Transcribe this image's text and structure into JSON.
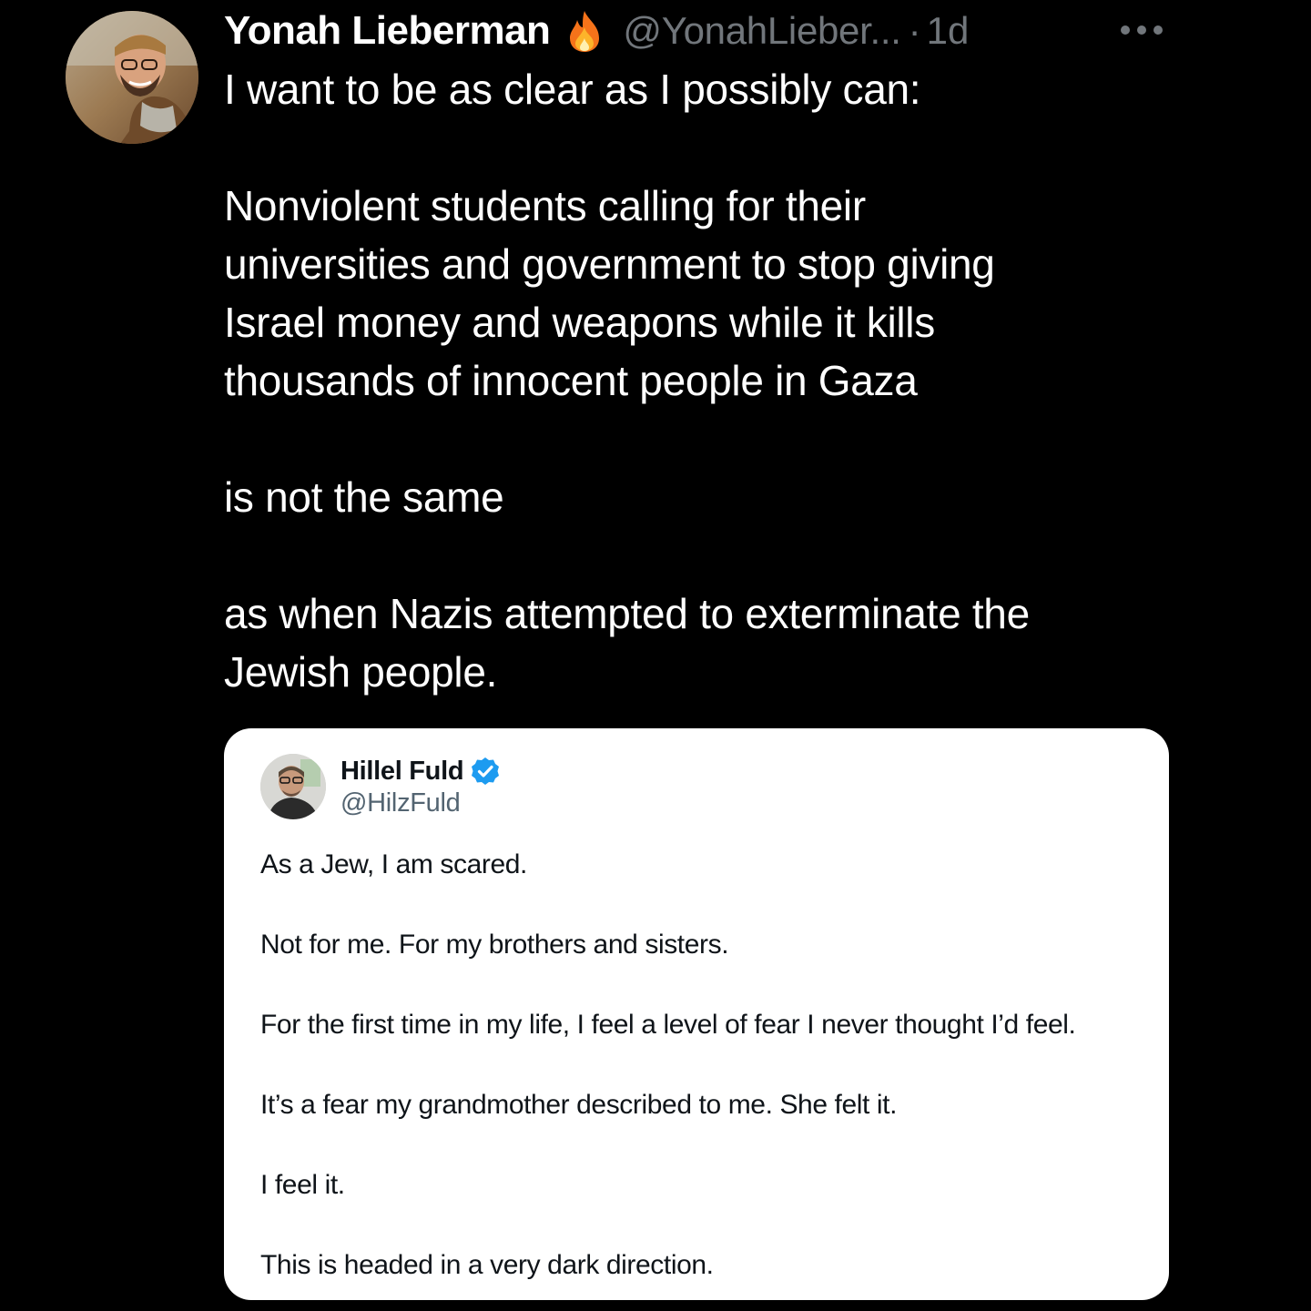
{
  "tweet": {
    "author_name": "Yonah Lieberman",
    "emoji_icon": "fire-icon",
    "handle": "@YonahLieber...",
    "separator": "·",
    "time": "1d",
    "more_icon": "more-horizontal-icon",
    "text_lines": [
      "I want to be as clear as I possibly can:",
      "",
      "Nonviolent students calling for their",
      "universities and government to stop giving",
      "Israel money and weapons while it kills",
      "thousands of innocent people in Gaza",
      "",
      "is not the same",
      "",
      "as when Nazis attempted to exterminate the",
      "Jewish people."
    ]
  },
  "quoted": {
    "author_name": "Hillel Fuld",
    "verified_icon": "verified-badge-icon",
    "handle": "@HilzFuld",
    "paragraphs": [
      "As a Jew, I am scared.",
      "Not for me. For my brothers and sisters.",
      "For the first time in my life, I feel a level of fear I never thought I’d feel.",
      "It’s a fear my grandmother described to me. She felt it.",
      "I feel it.",
      "This is headed in a very dark direction."
    ]
  },
  "colors": {
    "background": "#000000",
    "primary_text": "#ffffff",
    "secondary_text": "#71767b",
    "quote_background": "#ffffff",
    "quote_text": "#0f1419",
    "quote_secondary": "#536471",
    "verified_blue": "#1d9bf0"
  }
}
